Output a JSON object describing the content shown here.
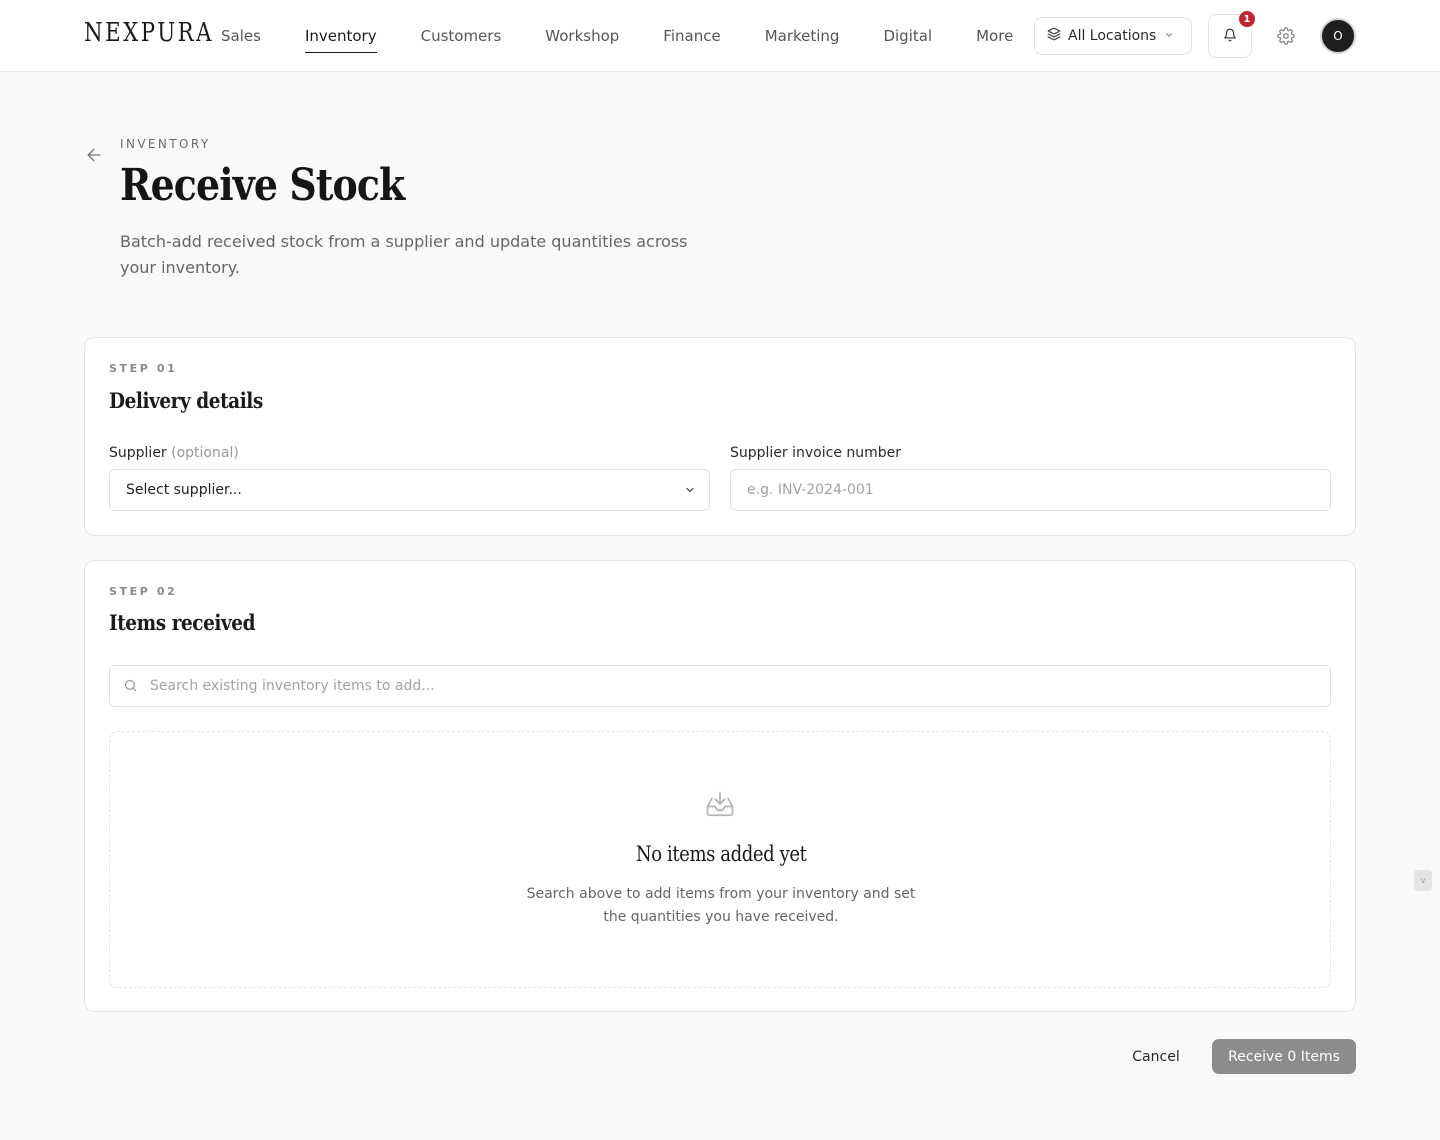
{
  "brand": {
    "logo": "NEXPURA"
  },
  "nav": {
    "items": [
      {
        "label": "Sales"
      },
      {
        "label": "Inventory"
      },
      {
        "label": "Customers"
      },
      {
        "label": "Workshop"
      },
      {
        "label": "Finance"
      },
      {
        "label": "Marketing"
      },
      {
        "label": "Digital"
      },
      {
        "label": "More"
      }
    ],
    "active": "Inventory"
  },
  "toolbar": {
    "location_label": "All Locations",
    "location_icon": "layers-icon",
    "notification_count": "1",
    "avatar_initial": "O"
  },
  "header": {
    "eyebrow": "INVENTORY",
    "title": "Receive Stock",
    "description": "Batch-add received stock from a supplier and update quantities across your inventory."
  },
  "step1": {
    "step_label": "STEP 01",
    "title": "Delivery details",
    "supplier_label": "Supplier",
    "supplier_optional": "(optional)",
    "supplier_value": "Select supplier...",
    "invoice_label": "Supplier invoice number",
    "invoice_placeholder": "e.g. INV-2024-001",
    "invoice_value": ""
  },
  "step2": {
    "step_label": "STEP 02",
    "title": "Items received",
    "search_placeholder": "Search existing inventory items to add...",
    "search_value": "",
    "empty_title": "No items added yet",
    "empty_description": "Search above to add items from your inventory and set the quantities you have received."
  },
  "actions": {
    "cancel_label": "Cancel",
    "submit_label": "Receive 0 Items"
  },
  "scroll_hint": "v",
  "colors": {
    "background": "#f9f9f8",
    "notification_badge": "#c0262d",
    "submit_disabled": "#8c8c8b"
  }
}
